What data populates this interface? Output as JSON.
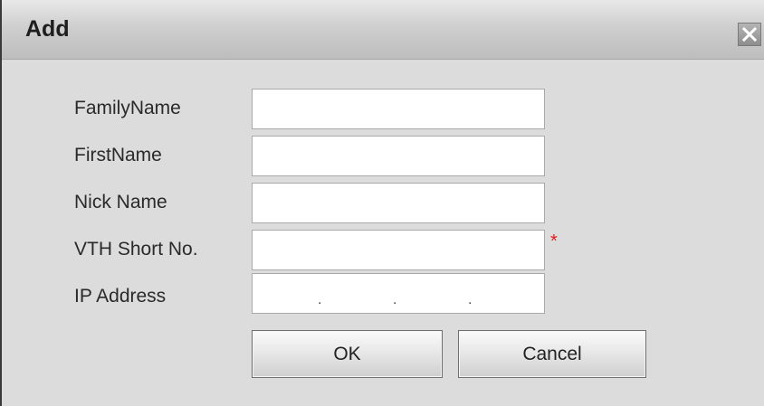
{
  "dialog": {
    "title": "Add",
    "close_icon": "close-icon"
  },
  "fields": {
    "family_name": {
      "label": "FamilyName",
      "value": ""
    },
    "first_name": {
      "label": "FirstName",
      "value": ""
    },
    "nick_name": {
      "label": "Nick Name",
      "value": ""
    },
    "vth_short_no": {
      "label": "VTH Short No.",
      "value": "",
      "required_mark": "*"
    },
    "ip_address": {
      "label": "IP Address",
      "separator": "."
    }
  },
  "buttons": {
    "ok": "OK",
    "cancel": "Cancel"
  },
  "colors": {
    "required": "#e01b1b",
    "background": "#dcdcdc"
  }
}
